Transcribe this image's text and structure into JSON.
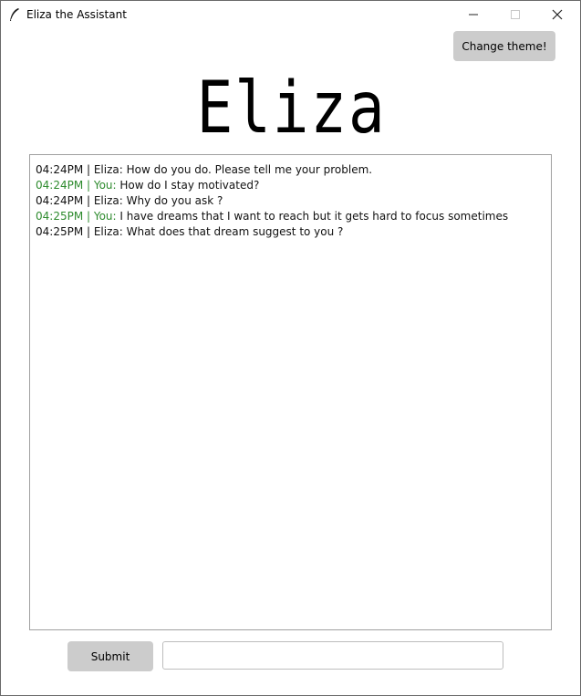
{
  "window": {
    "title": "Eliza the Assistant",
    "controls": {
      "minimize": "—",
      "maximize": "☐",
      "close": "✕"
    }
  },
  "toolbar": {
    "theme_button_label": "Change theme!"
  },
  "header": {
    "logo_text": "Eliza"
  },
  "chat": {
    "messages": [
      {
        "time": "04:24PM",
        "speaker": "Eliza",
        "text": "How do you do.  Please tell me your problem.",
        "is_user": false
      },
      {
        "time": "04:24PM",
        "speaker": "You",
        "text": "How do I stay motivated?",
        "is_user": true
      },
      {
        "time": "04:24PM",
        "speaker": "Eliza",
        "text": "Why do you ask ?",
        "is_user": false
      },
      {
        "time": "04:25PM",
        "speaker": "You",
        "text": "I have dreams that I want to reach but it gets hard to focus sometimes",
        "is_user": true
      },
      {
        "time": "04:25PM",
        "speaker": "Eliza",
        "text": "What does that dream suggest to you ?",
        "is_user": false
      }
    ]
  },
  "input": {
    "value": "",
    "placeholder": ""
  },
  "actions": {
    "submit_label": "Submit"
  },
  "colors": {
    "user_prefix": "#2e8b2e",
    "button_bg": "#cccccc"
  }
}
